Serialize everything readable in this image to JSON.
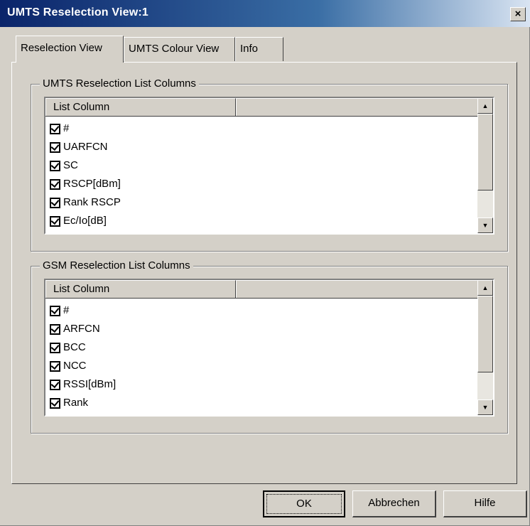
{
  "window": {
    "title": "UMTS Reselection View:1",
    "close_glyph": "×"
  },
  "tabs": [
    {
      "label": "Reselection View",
      "active": true
    },
    {
      "label": "UMTS Colour View",
      "active": false
    },
    {
      "label": "Info",
      "active": false
    }
  ],
  "umts_group": {
    "title": "UMTS Reselection List Columns",
    "header": "List Column",
    "items": [
      {
        "label": "#",
        "checked": true
      },
      {
        "label": "UARFCN",
        "checked": true
      },
      {
        "label": "SC",
        "checked": true
      },
      {
        "label": "RSCP[dBm]",
        "checked": true
      },
      {
        "label": "Rank RSCP",
        "checked": true
      },
      {
        "label": "Ec/Io[dB]",
        "checked": true
      }
    ]
  },
  "gsm_group": {
    "title": "GSM Reselection List Columns",
    "header": "List Column",
    "items": [
      {
        "label": "#",
        "checked": true
      },
      {
        "label": "ARFCN",
        "checked": true
      },
      {
        "label": "BCC",
        "checked": true
      },
      {
        "label": "NCC",
        "checked": true
      },
      {
        "label": "RSSI[dBm]",
        "checked": true
      },
      {
        "label": "Rank",
        "checked": true
      }
    ]
  },
  "scroll_glyphs": {
    "up": "▲",
    "down": "▼"
  },
  "buttons": {
    "ok": "OK",
    "cancel": "Abbrechen",
    "help": "Hilfe"
  },
  "colors": {
    "title_gradient_start": "#0a246a",
    "title_gradient_end": "#d9e4f2",
    "dialog_face": "#d4d0c8"
  }
}
